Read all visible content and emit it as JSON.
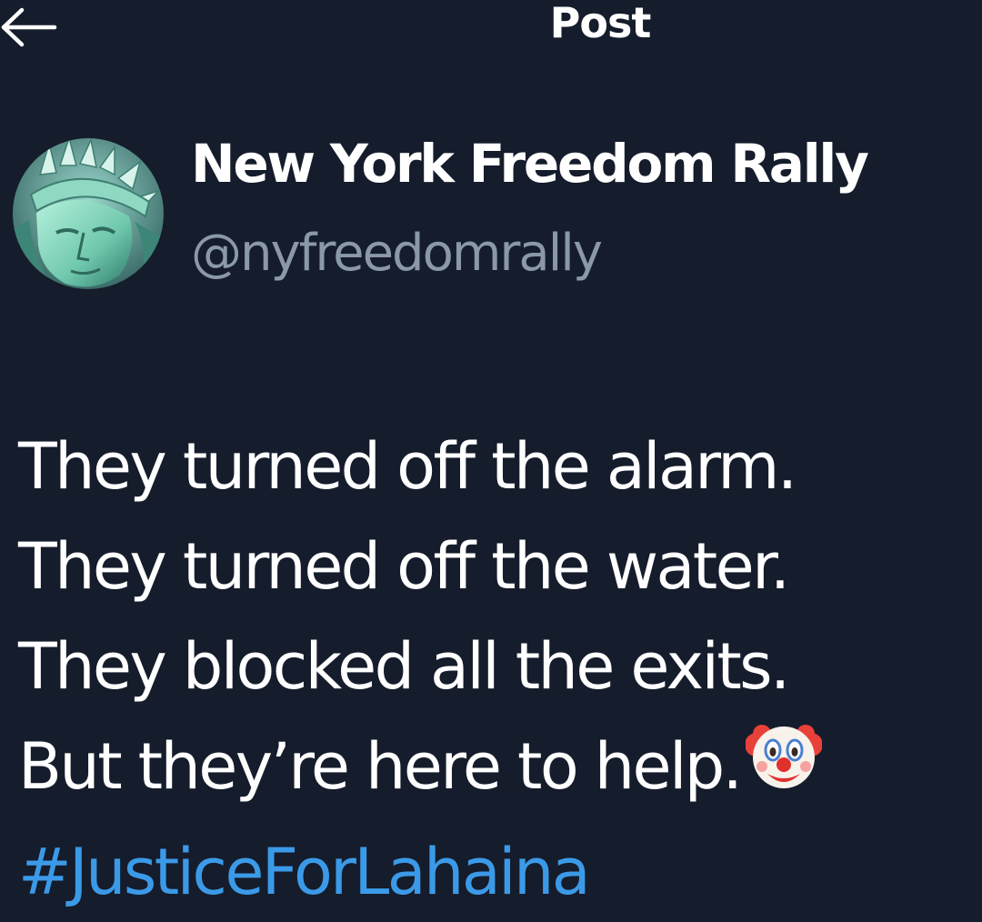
{
  "header": {
    "title": "Post",
    "back_icon": "back-arrow-icon"
  },
  "author": {
    "display_name": "New York Freedom Rally",
    "handle": "@nyfreedomrally",
    "avatar_icon": "statue-of-liberty-avatar"
  },
  "post": {
    "lines": [
      "They turned off the alarm.",
      "They turned off the water.",
      "They blocked all the exits.",
      "But they’re here to help."
    ],
    "trailing_emoji": "clown-face-icon",
    "hashtag": "#JusticeForLahaina"
  },
  "colors": {
    "background": "#151c2b",
    "text": "#ffffff",
    "handle": "#8a98a8",
    "link": "#3b9ae8"
  }
}
